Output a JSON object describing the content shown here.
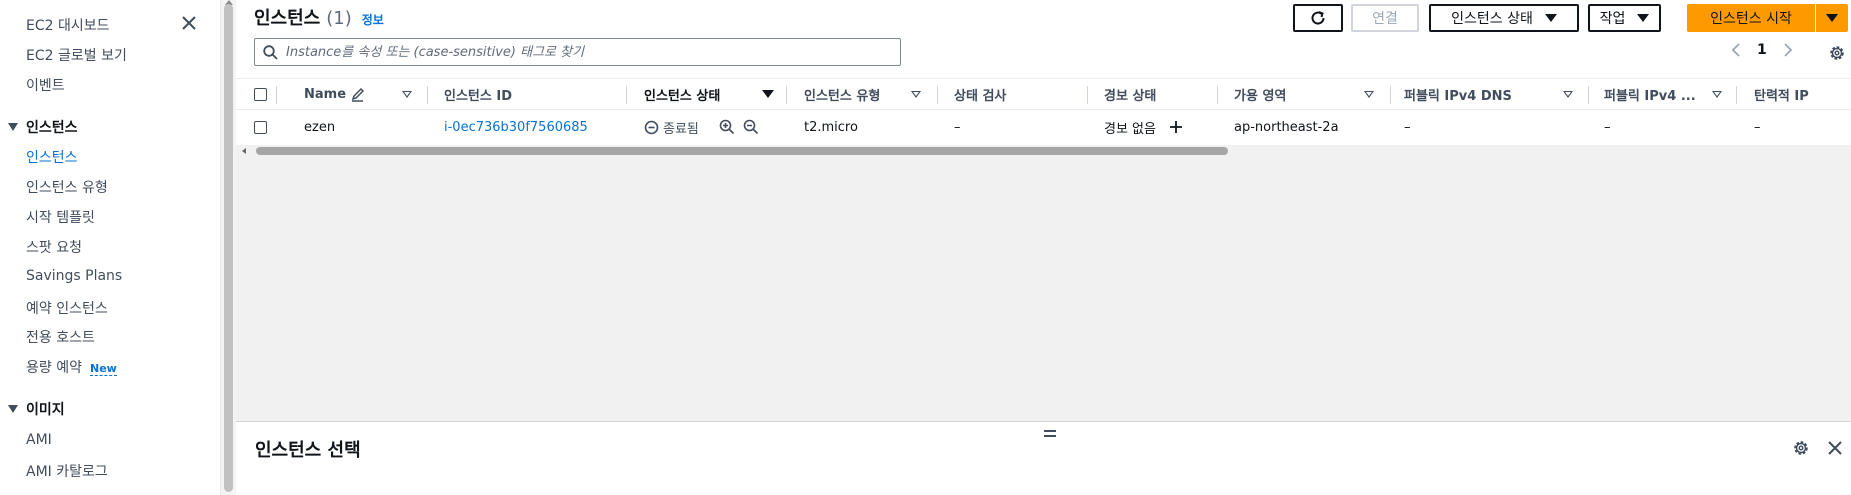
{
  "sidebar": {
    "items_top": [
      {
        "label": "EC2 대시보드"
      },
      {
        "label": "EC2 글로벌 보기"
      },
      {
        "label": "이벤트"
      }
    ],
    "section_instances": "인스턴스",
    "instances_items": [
      {
        "label": "인스턴스",
        "active": true
      },
      {
        "label": "인스턴스 유형"
      },
      {
        "label": "시작 템플릿"
      },
      {
        "label": "스팟 요청"
      },
      {
        "label": "Savings Plans"
      },
      {
        "label": "예약 인스턴스"
      },
      {
        "label": "전용 호스트"
      },
      {
        "label": "용량 예약",
        "badge": "New"
      }
    ],
    "section_images": "이미지",
    "images_items": [
      {
        "label": "AMI"
      },
      {
        "label": "AMI 카탈로그"
      }
    ]
  },
  "header": {
    "title": "인스턴스",
    "count": "(1)",
    "info": "정보"
  },
  "toolbar": {
    "connect": "연결",
    "instance_state": "인스턴스 상태",
    "actions": "작업",
    "launch": "인스턴스 시작"
  },
  "search": {
    "placeholder": "Instance를 속성 또는 (case-sensitive) 태그로 찾기"
  },
  "pagination": {
    "page": "1"
  },
  "table": {
    "columns": [
      "Name",
      "인스턴스 ID",
      "인스턴스 상태",
      "인스턴스 유형",
      "상태 검사",
      "경보 상태",
      "가용 영역",
      "퍼블릭 IPv4 DNS",
      "퍼블릭 IPv4 ...",
      "탄력적 IP"
    ],
    "rows": [
      {
        "name": "ezen",
        "instance_id": "i-0ec736b30f7560685",
        "state": "종료됨",
        "type": "t2.micro",
        "status_check": "–",
        "alarm": "경보 없음",
        "az": "ap-northeast-2a",
        "public_dns": "–",
        "public_ip": "–",
        "elastic_ip": "–"
      }
    ]
  },
  "split_panel": {
    "title": "인스턴스 선택"
  },
  "colors": {
    "accent": "#0972d3",
    "primary_button": "#ff9900",
    "text": "#0f141a"
  }
}
